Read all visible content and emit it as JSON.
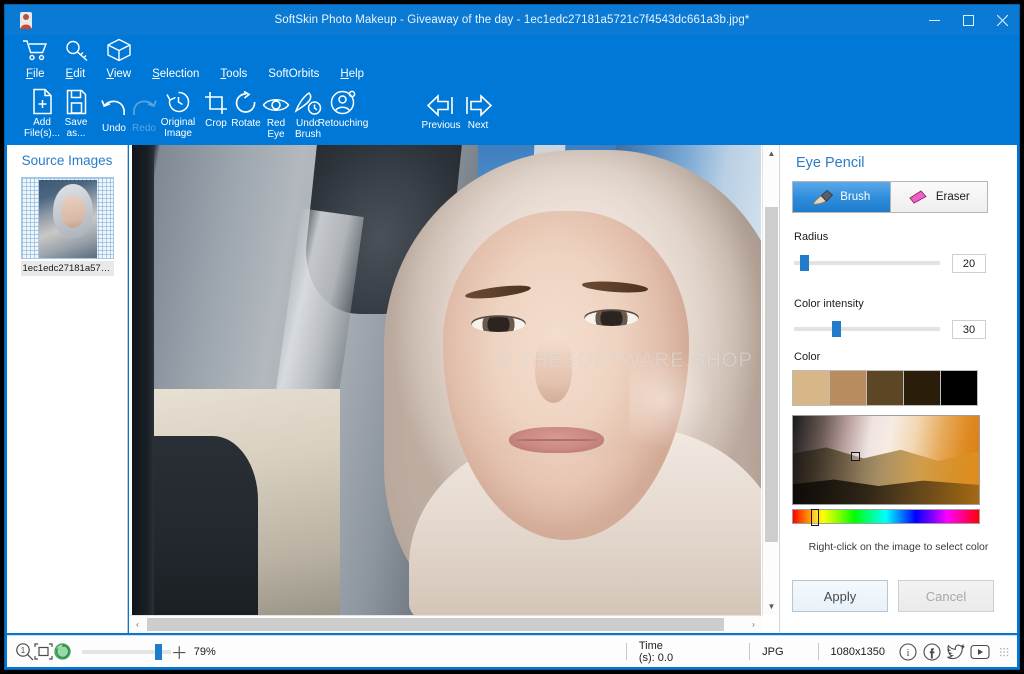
{
  "window": {
    "title": "SoftSkin Photo Makeup - Giveaway of the day - 1ec1edc27181a5721c7f4543dc661a3b.jpg*",
    "minimize_label": "─",
    "maximize_label": "□",
    "close_label": "✕",
    "accent_color": "#0078d7"
  },
  "quick_icons": [
    {
      "name": "cart-icon"
    },
    {
      "name": "key-icon"
    },
    {
      "name": "box-icon"
    }
  ],
  "menu": {
    "items": [
      {
        "label": "File",
        "accel": "F"
      },
      {
        "label": "Edit",
        "accel": "E"
      },
      {
        "label": "View",
        "accel": "V"
      },
      {
        "label": "Selection",
        "accel": "S"
      },
      {
        "label": "Tools",
        "accel": "T"
      },
      {
        "label": "SoftOrbits",
        "accel": ""
      },
      {
        "label": "Help",
        "accel": "H"
      }
    ]
  },
  "toolbar": {
    "items": [
      {
        "label": "Add\nFile(s)...",
        "icon": "add-file-icon",
        "disabled": false
      },
      {
        "label": "Save\nas...",
        "icon": "save-icon",
        "disabled": false
      },
      {
        "label": "Undo",
        "icon": "undo-icon",
        "disabled": false
      },
      {
        "label": "Redo",
        "icon": "redo-icon",
        "disabled": true
      },
      {
        "label": "Original\nImage",
        "icon": "original-image-icon",
        "disabled": false
      },
      {
        "label": "Crop",
        "icon": "crop-icon",
        "disabled": false
      },
      {
        "label": "Rotate",
        "icon": "rotate-icon",
        "disabled": false
      },
      {
        "label": "Red\nEye",
        "icon": "red-eye-icon",
        "disabled": false
      },
      {
        "label": "Undo\nBrush",
        "icon": "undo-brush-icon",
        "disabled": false
      },
      {
        "label": "Retouching",
        "icon": "retouching-icon",
        "disabled": false
      },
      {
        "label": "Previous",
        "icon": "previous-arrow-icon",
        "disabled": false
      },
      {
        "label": "Next",
        "icon": "next-arrow-icon",
        "disabled": false
      }
    ]
  },
  "sidebar": {
    "title": "Source Images",
    "items": [
      {
        "filename": "1ec1edc27181a5721c..."
      }
    ]
  },
  "canvas": {
    "watermark": "© THESOFTWARE.SHOP",
    "scroll_up_glyph": "▲",
    "scroll_down_glyph": "▼",
    "scroll_left_glyph": "‹",
    "scroll_right_glyph": "›"
  },
  "right_panel": {
    "title": "Eye Pencil",
    "modes": [
      {
        "label": "Brush",
        "icon": "brush-icon",
        "active": true
      },
      {
        "label": "Eraser",
        "icon": "eraser-icon",
        "active": false
      }
    ],
    "radius": {
      "label": "Radius",
      "value": "20",
      "percent": 8
    },
    "color_intensity": {
      "label": "Color intensity",
      "value": "30",
      "percent": 26
    },
    "color": {
      "label": "Color",
      "swatches": [
        "#d7b687",
        "#b88c5e",
        "#5c4626",
        "#2a1e0a",
        "#000000"
      ],
      "hint": "Right-click on the image to select color"
    },
    "buttons": {
      "apply": "Apply",
      "cancel": "Cancel"
    }
  },
  "statusbar": {
    "zoom_icon": "zoom-1to1-icon",
    "fit_icon": "fit-to-window-icon",
    "refresh_icon": "refresh-icon",
    "zoom_plus": "＋",
    "zoom_percent": "79%",
    "time": "Time (s): 0.0",
    "format": "JPG",
    "dimensions": "1080x1350",
    "social": [
      {
        "name": "info-icon",
        "label": "i"
      },
      {
        "name": "facebook-icon",
        "label": "f"
      },
      {
        "name": "twitter-icon",
        "label": "t"
      },
      {
        "name": "youtube-icon",
        "label": "▶"
      }
    ]
  }
}
